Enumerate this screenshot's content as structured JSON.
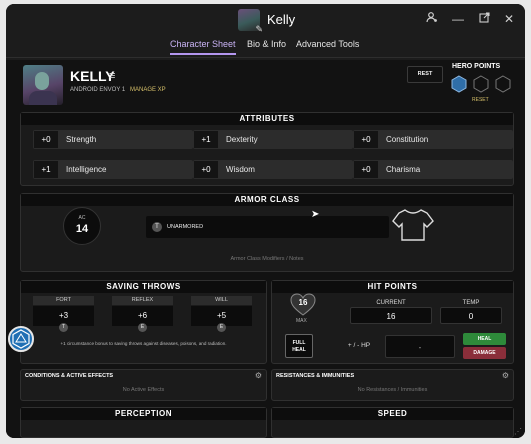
{
  "window": {
    "title": "Kelly",
    "buttons": [
      "person-settings-icon",
      "minimize-icon",
      "popout-icon",
      "close-icon"
    ]
  },
  "tabs": [
    {
      "label": "Character Sheet",
      "active": true
    },
    {
      "label": "Bio & Info",
      "active": false
    },
    {
      "label": "Advanced Tools",
      "active": false
    }
  ],
  "character": {
    "name": "KELLY",
    "subline": "ANDROID ENVOY 1",
    "manage_xp": "MANAGE XP"
  },
  "rest_label": "REST",
  "hero_points": {
    "title": "HERO POINTS",
    "filled": 1,
    "total": 3,
    "reset_label": "RESET"
  },
  "attributes": {
    "title": "ATTRIBUTES",
    "items": [
      {
        "mod": "+0",
        "name": "Strength"
      },
      {
        "mod": "+1",
        "name": "Dexterity"
      },
      {
        "mod": "+0",
        "name": "Constitution"
      },
      {
        "mod": "+1",
        "name": "Intelligence"
      },
      {
        "mod": "+0",
        "name": "Wisdom"
      },
      {
        "mod": "+0",
        "name": "Charisma"
      }
    ]
  },
  "armor_class": {
    "title": "ARMOR CLASS",
    "ac_label": "AC",
    "ac_value": "14",
    "rank": "T",
    "armor": "UNARMORED",
    "notes": "Armor Class Modifiers / Notes"
  },
  "saving_throws": {
    "title": "SAVING THROWS",
    "items": [
      {
        "label": "FORT",
        "value": "+3",
        "rank": "T"
      },
      {
        "label": "REFLEX",
        "value": "+6",
        "rank": "E"
      },
      {
        "label": "WILL",
        "value": "+5",
        "rank": "E"
      }
    ],
    "note": "+1 circumstance bonus to saving throws against diseases, poisons, and radiation."
  },
  "hit_points": {
    "title": "HIT POINTS",
    "max": "16",
    "max_label": "MAX",
    "current_label": "CURRENT",
    "current": "16",
    "temp_label": "TEMP",
    "temp": "0",
    "full_heal": "FULL HEAL",
    "adjust_label": "+ / - HP",
    "adjust_value": "-",
    "heal": "HEAL",
    "damage": "DAMAGE"
  },
  "conditions": {
    "title": "CONDITIONS & ACTIVE EFFECTS",
    "empty": "No Active Effects"
  },
  "resistances": {
    "title": "RESISTANCES & IMMUNITIES",
    "empty": "No Resistances / Immunities"
  },
  "perception": {
    "title": "PERCEPTION"
  },
  "speed": {
    "title": "SPEED"
  },
  "colors": {
    "accent": "#b497f0",
    "heal": "#2e8a3a",
    "damage": "#8a2e3a",
    "hero_point": "#2f6ea8",
    "gold": "#d6c06a"
  }
}
